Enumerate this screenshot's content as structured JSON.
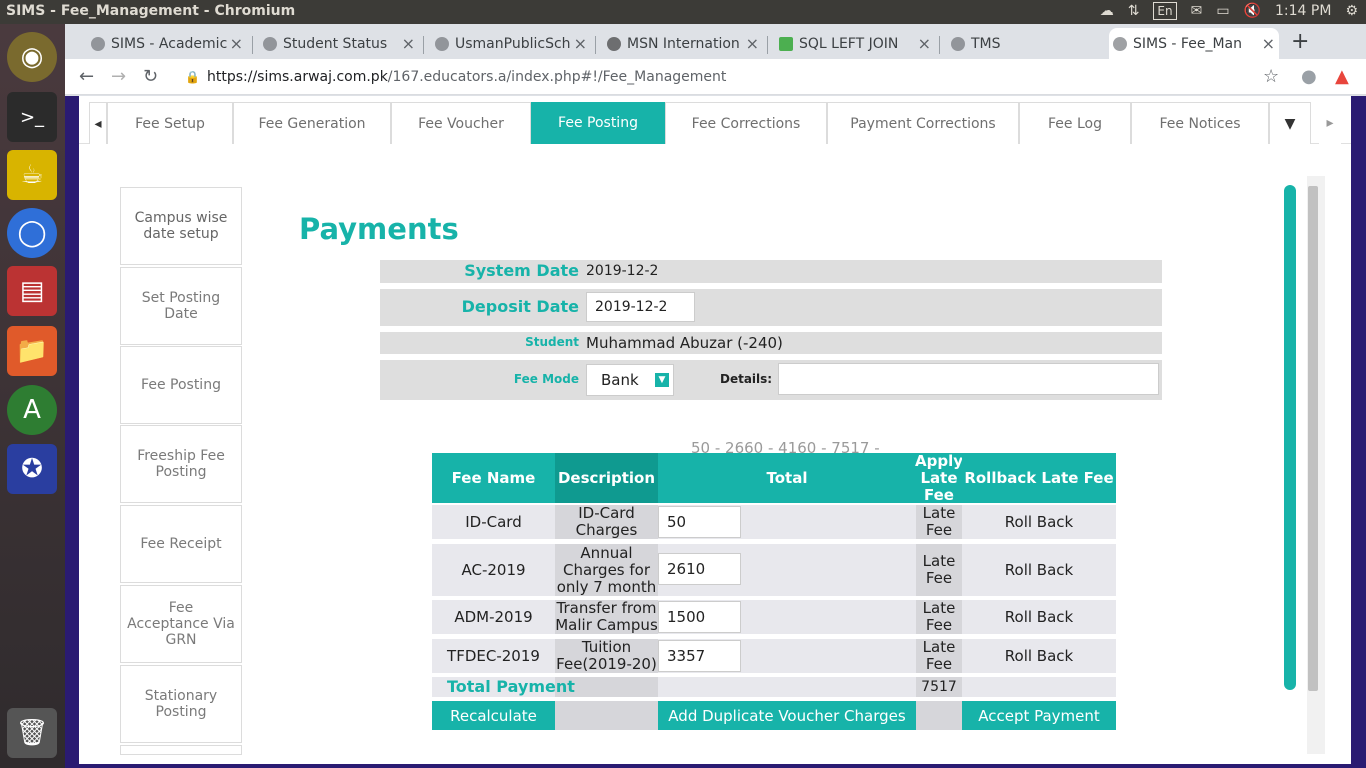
{
  "os": {
    "window_title": "SIMS - Fee_Management - Chromium",
    "keyboard_layout": "En",
    "clock": "1:14 PM"
  },
  "browser": {
    "tabs": [
      {
        "label": "SIMS - Academic"
      },
      {
        "label": "Student Status"
      },
      {
        "label": "UsmanPublicSch"
      },
      {
        "label": "MSN Internation"
      },
      {
        "label": "SQL LEFT JOIN"
      },
      {
        "label": "TMS"
      },
      {
        "label": "SIMS - Fee_Man"
      }
    ],
    "url_host": "https://sims.arwaj.com.pk",
    "url_path": "/167.educators.a/index.php#!/Fee_Management"
  },
  "fee_tabs": [
    "Fee Setup",
    "Fee Generation",
    "Fee Voucher",
    "Fee Posting",
    "Fee Corrections",
    "Payment Corrections",
    "Fee Log",
    "Fee Notices"
  ],
  "left_menu": [
    "Campus wise date setup",
    "Set Posting Date",
    "Fee Posting",
    "Freeship Fee Posting",
    "Fee Receipt",
    "Fee Acceptance Via GRN",
    "Stationary Posting"
  ],
  "payments": {
    "title": "Payments",
    "system_date_label": "System Date",
    "system_date": "2019-12-2",
    "deposit_date_label": "Deposit Date",
    "deposit_date": "2019-12-2",
    "student_label": "Student",
    "student": "Muhammad Abuzar (-240)",
    "fee_mode_label": "Fee Mode",
    "fee_mode": "Bank",
    "details_label": "Details:",
    "details": ""
  },
  "fee_summary": "50 - 2660 - 4160 - 7517 -",
  "table": {
    "headers": {
      "fee_name": "Fee Name",
      "description": "Description",
      "total": "Total",
      "apply_late_fee": "Apply Late Fee",
      "rollback": "Rollback Late Fee"
    },
    "rows": [
      {
        "fee_name": "ID-Card",
        "description": "ID-Card Charges",
        "total": "50",
        "late": "Late Fee",
        "rollback": "Roll Back"
      },
      {
        "fee_name": "AC-2019",
        "description": "Annual Charges for only 7 month",
        "total": "2610",
        "late": "Late Fee",
        "rollback": "Roll Back"
      },
      {
        "fee_name": "ADM-2019",
        "description": "Transfer from Malir Campus",
        "total": "1500",
        "late": "Late Fee",
        "rollback": "Roll Back"
      },
      {
        "fee_name": "TFDEC-2019",
        "description": "Tuition Fee(2019-20)",
        "total": "3357",
        "late": "Late Fee",
        "rollback": "Roll Back"
      }
    ],
    "total_label": "Total Payment",
    "total_value": "7517",
    "buttons": {
      "recalculate": "Recalculate",
      "add_duplicate": "Add Duplicate Voucher Charges",
      "accept": "Accept Payment"
    }
  },
  "colors": {
    "accent": "#17b3a9",
    "page_border": "#2a1b72"
  }
}
